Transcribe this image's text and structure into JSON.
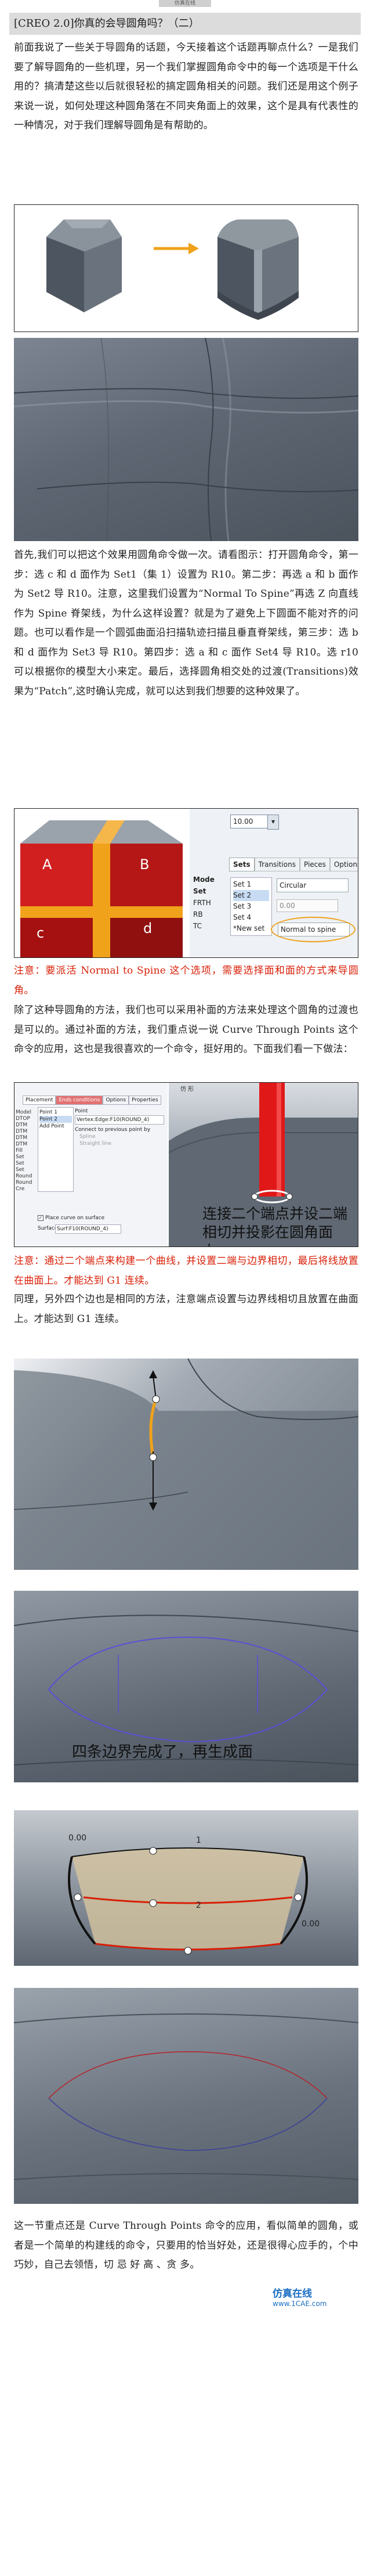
{
  "header_logo": "仿真在线",
  "title": "[CREO 2.0]你真的会导圆角吗？（二）",
  "p1": "前面我说了一些关于导圆角的话题，今天接着这个话题再聊点什么？一是我们要了解导圆角的一些机理，另一个我们掌握圆角命令中的每一个选项是干什么用的？搞清楚这些以后就很轻松的搞定圆角相关的问题。我们还是用这个例子来说一说，如何处理这种圆角落在不同夹角面上的效果，这个是具有代表性的一种情况，对于我们理解导圆角是有帮助的。",
  "p2": "首先,我们可以把这个效果用圆角命令做一次。请看图示：打开圆角命令，第一步：选 c 和 d 面作为 Set1（集 1）设置为 R10。第二步：再选 a 和 b 面作为 Set2 导 R10。注意，这里我们设置为“Normal To Spine”再选 Z 向直线作为 Spine 脊架线，为什么这样设置？就是为了避免上下圆面不能对齐的问题。也可以看作是一个圆弧曲面沿扫描轨迹扫描且垂直脊架线，第三步：选 b 和 d 面作为 Set3 导 R10。第四步：选 a 和 c 面作 Set4 导 R10。选 r10 可以根据你的模型大小来定。最后，选择圆角相交处的过渡(Transitions)效果为“Patch”,这时确认完成，就可以达到我们想要的这种效果了。",
  "fig3": {
    "labels": {
      "a": "A",
      "b": "B",
      "c": "c",
      "d": "d"
    },
    "panel": {
      "field_value": "10.00",
      "tabs": [
        "Sets",
        "Transitions",
        "Pieces",
        "Options"
      ],
      "mode_labels": [
        "Mode",
        "Set",
        "FRTH",
        "RB",
        "TC"
      ],
      "sets": [
        "Set 1",
        "Set 2",
        "Set 3",
        "Set 4",
        "*New set"
      ],
      "type": "Circular",
      "radius": "0.00",
      "spine_option": "Normal to spine"
    }
  },
  "note1": "注意：要派活 Normal to Spine 这个选项，需要选择面和面的方式来导圆角。",
  "p3": "除了这种导圆角的方法，我们也可以采用补面的方法来处理这个圆角的过渡也是可以的。通过补面的方法，我们重点说一说 Curve Through Points 这个命令的应用，这也是我很喜欢的一个命令，挺好用的。下面我们看一下做法：",
  "fig4": {
    "tabs": [
      "Placement",
      "Ends conditions",
      "Options",
      "Properties"
    ],
    "list_items": [
      "Point 1",
      "Point 2",
      "Add Point"
    ],
    "field_label": "Point",
    "field_value": "Vertex:Edge:F10(ROUND_4)",
    "option1": "Connect to previous point by",
    "option2": "Spline",
    "option3": "Straight line",
    "tree": [
      "Model",
      "DTOP",
      "DTM",
      "DTM",
      "DTM",
      "DTM",
      "Fill",
      "Set",
      "Set",
      "Set",
      "Round",
      "Round",
      "Cre"
    ],
    "checkbox": "Place curve on surface",
    "surface_label": "Surface",
    "surface_value": "Surf:F10(ROUND_4)",
    "title": "仿 形",
    "caption": "连接二个端点并设二端相切并投影在圆角面上。"
  },
  "note2": "注意：通过二个端点来构建一个曲线，并设置二端与边界相切，最后将线放置在曲面上。才能达到 G1 连续。",
  "p4": "同理，另外四个边也是相同的方法，注意端点设置与边界线相切且放置在曲面上。才能达到 G1 连续。",
  "fig7_caption": "四条边界完成了，再生成面",
  "fig8": {
    "label_1": "1",
    "label_2": "2",
    "value_left": "0.00",
    "value_right": "0.00"
  },
  "p5": "这一节重点还是 Curve Through Points 命令的应用，看似简单的圆角，或者是一个简单的构建线的命令，只要用的恰当好处，还是很得心应手的，个中巧妙，自己去领悟，切 忌 好 高 、贪 多。",
  "watermark_site": "www.1CAE.com",
  "watermark_logo": "仿真在线",
  "colors": {
    "red": "#d81e06",
    "orange": "#f0a21a",
    "model_grey": "#6c7683",
    "dark_red": "#a81313"
  }
}
